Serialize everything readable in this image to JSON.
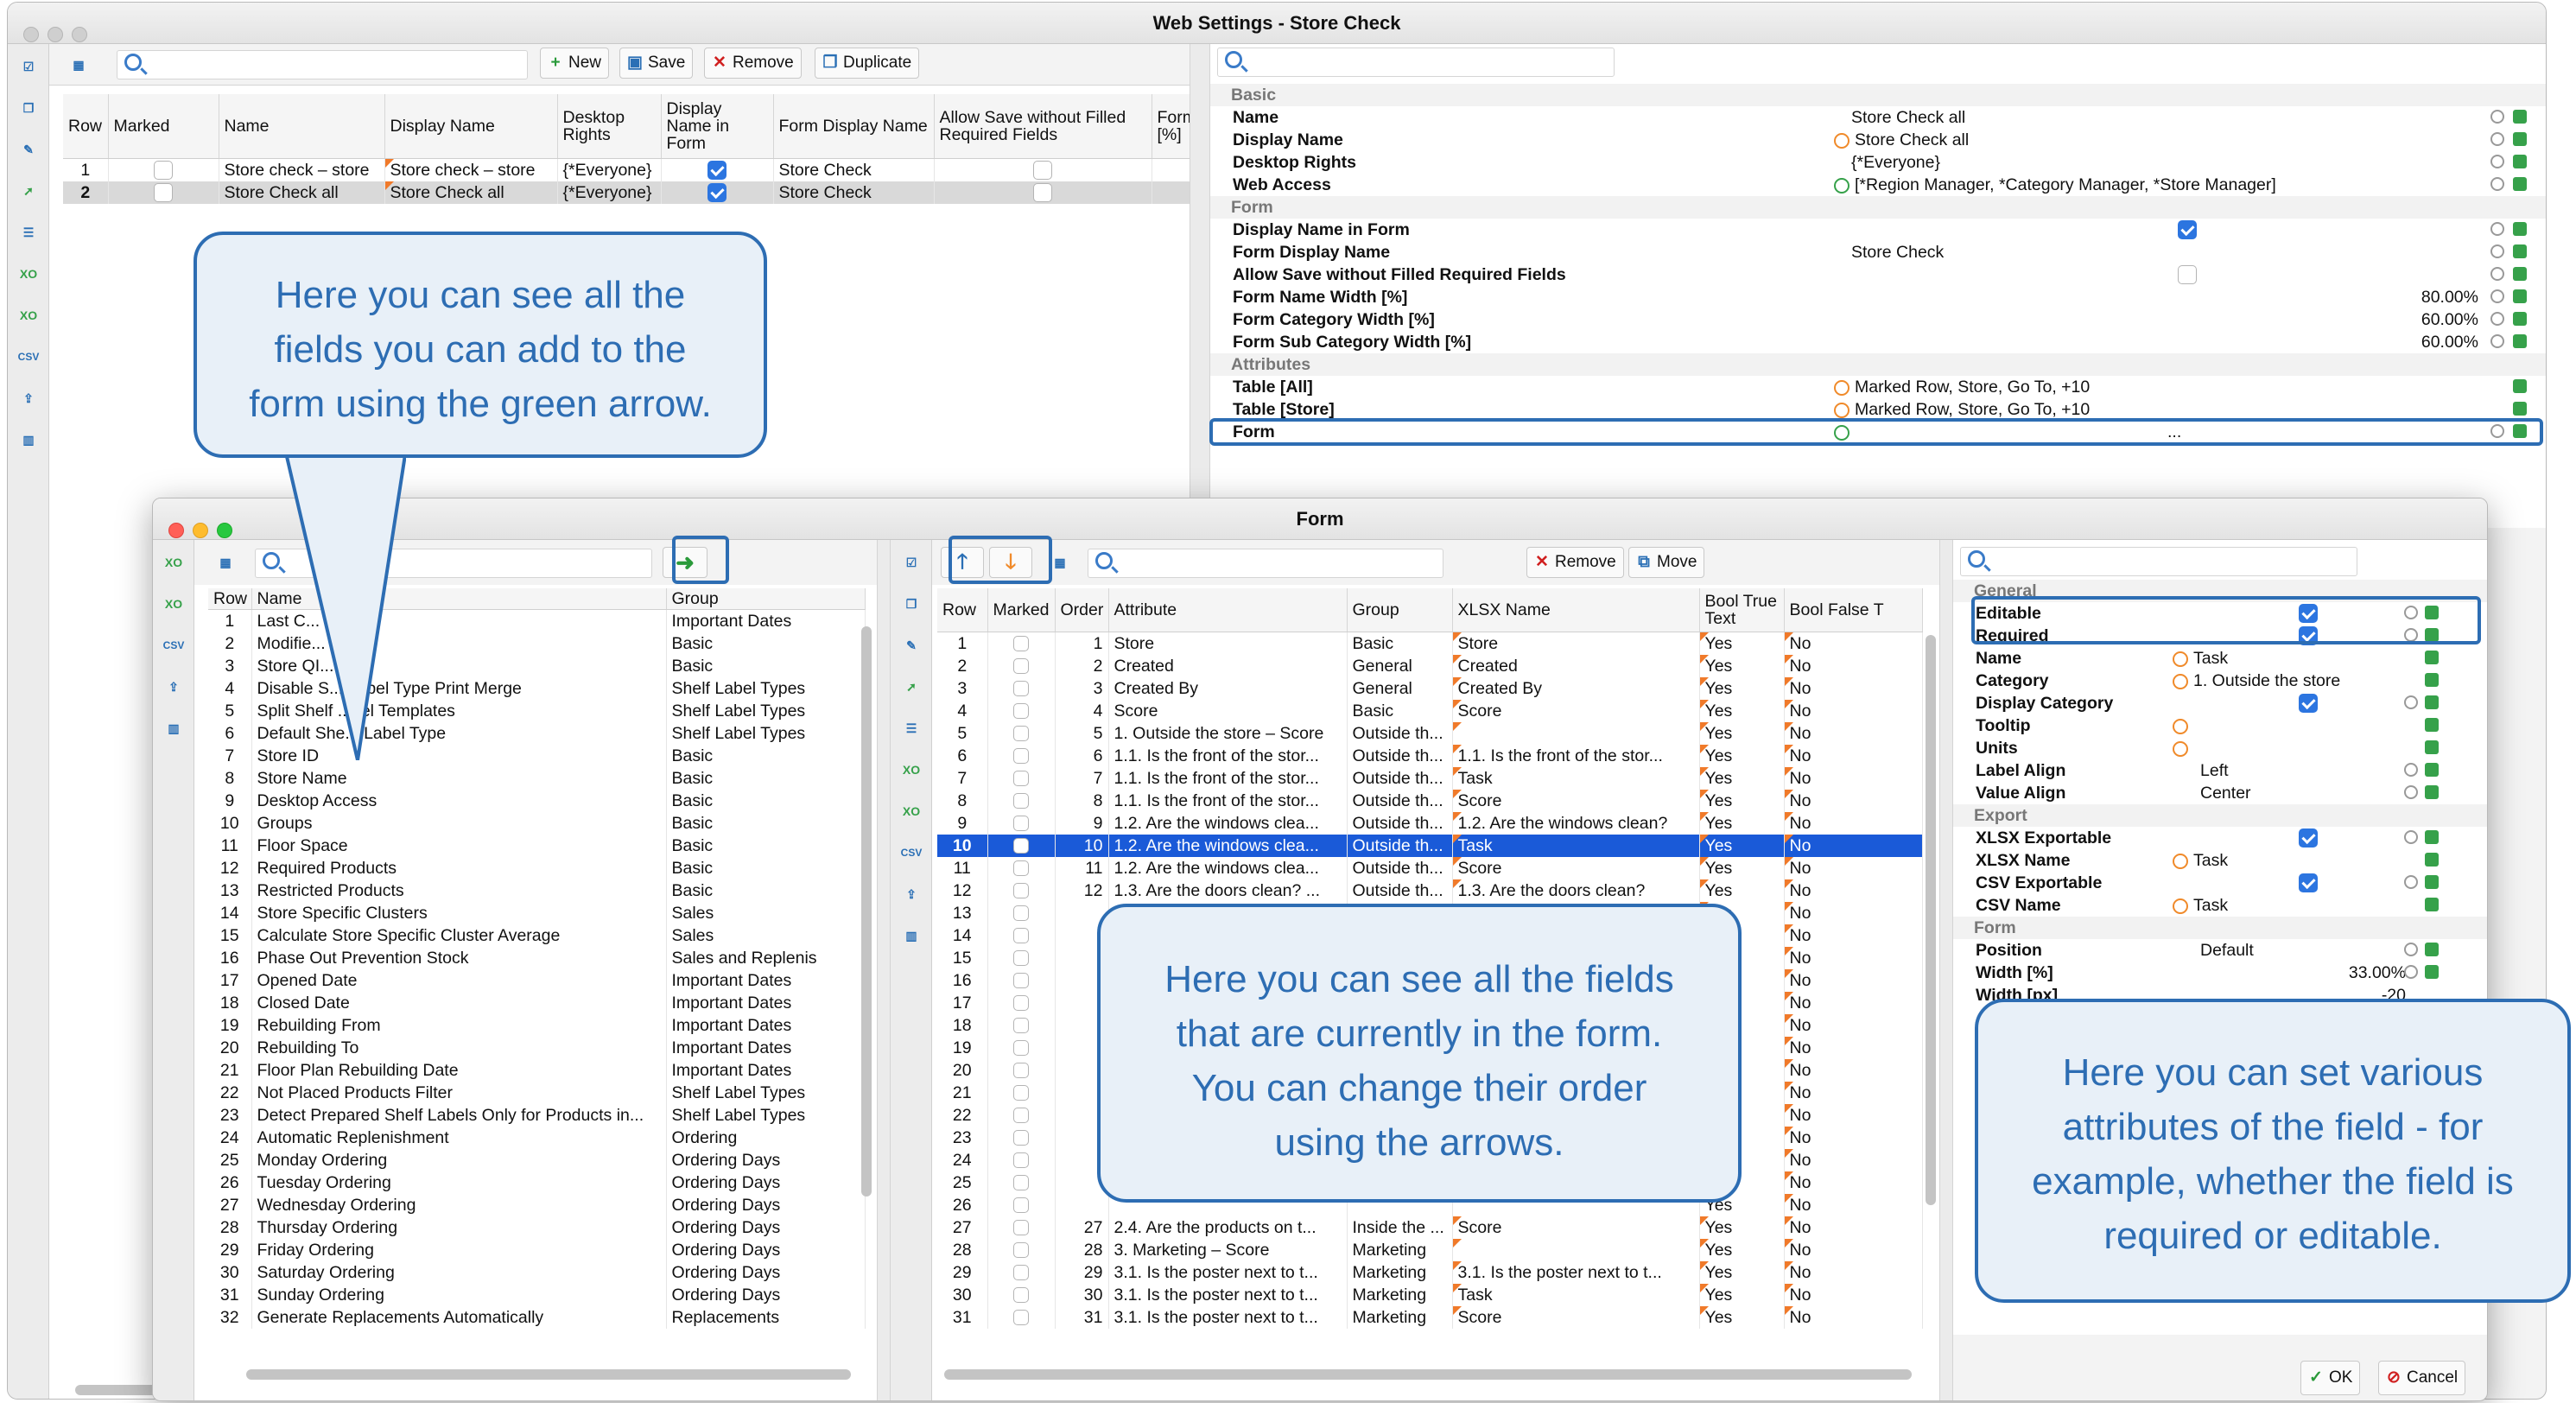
{
  "main_window": {
    "title": "Web Settings - Store Check",
    "toolbar": {
      "new_label": "New",
      "save_label": "Save",
      "remove_label": "Remove",
      "duplicate_label": "Duplicate"
    },
    "table": {
      "headers": {
        "row": "Row",
        "marked": "Marked",
        "name": "Name",
        "display_name": "Display Name",
        "desktop_rights": "Desktop Rights",
        "display_name_in_form": "Display Name in Form",
        "form_display_name": "Form Display Name",
        "allow_save": "Allow Save without Filled Required Fields",
        "form_pct": "Form [%]"
      },
      "rows": [
        {
          "row": "1",
          "name": "Store check – store",
          "display_name": "Store check – store",
          "desktop_rights": "{*Everyone}",
          "form_display_name": "Store Check"
        },
        {
          "row": "2",
          "name": "Store Check all",
          "display_name": "Store Check all",
          "desktop_rights": "{*Everyone}",
          "form_display_name": "Store Check"
        }
      ]
    },
    "properties": {
      "sections": {
        "basic": "Basic",
        "form": "Form",
        "attributes": "Attributes"
      },
      "basic": [
        {
          "key": "Name",
          "value": "Store Check all"
        },
        {
          "key": "Display Name",
          "value": "Store Check all"
        },
        {
          "key": "Desktop Rights",
          "value": "{*Everyone}"
        },
        {
          "key": "Web Access",
          "value": "[*Region Manager, *Category Manager, *Store Manager]"
        }
      ],
      "form": [
        {
          "key": "Display Name in Form",
          "value": ""
        },
        {
          "key": "Form Display Name",
          "value": "Store Check"
        },
        {
          "key": "Allow Save without Filled Required Fields",
          "value": ""
        },
        {
          "key": "Form Name Width [%]",
          "value": "80.00%"
        },
        {
          "key": "Form Category Width [%]",
          "value": "60.00%"
        },
        {
          "key": "Form Sub Category Width [%]",
          "value": "60.00%"
        }
      ],
      "attributes": [
        {
          "key": "Table [All]",
          "value": "Marked Row, Store, Go To, +10"
        },
        {
          "key": "Table [Store]",
          "value": "Marked Row, Store, Go To, +10"
        },
        {
          "key": "Form",
          "value": "..."
        }
      ]
    }
  },
  "form_window": {
    "title": "Form",
    "left_table": {
      "headers": {
        "row": "Row",
        "name": "Name",
        "group": "Group"
      },
      "rows": [
        [
          "1",
          "Last C...",
          "Important Dates"
        ],
        [
          "2",
          "Modifie...",
          "Basic"
        ],
        [
          "3",
          "Store QI...",
          "Basic"
        ],
        [
          "4",
          "Disable S... Label Type Print Merge",
          "Shelf Label Types"
        ],
        [
          "5",
          "Split Shelf ...bel Templates",
          "Shelf Label Types"
        ],
        [
          "6",
          "Default She... Label Type",
          "Shelf Label Types"
        ],
        [
          "7",
          "Store ID",
          "Basic"
        ],
        [
          "8",
          "Store Name",
          "Basic"
        ],
        [
          "9",
          "Desktop Access",
          "Basic"
        ],
        [
          "10",
          "Groups",
          "Basic"
        ],
        [
          "11",
          "Floor Space",
          "Basic"
        ],
        [
          "12",
          "Required Products",
          "Basic"
        ],
        [
          "13",
          "Restricted Products",
          "Basic"
        ],
        [
          "14",
          "Store Specific Clusters",
          "Sales"
        ],
        [
          "15",
          "Calculate Store Specific Cluster Average",
          "Sales"
        ],
        [
          "16",
          "Phase Out Prevention Stock",
          "Sales and Replenis"
        ],
        [
          "17",
          "Opened Date",
          "Important Dates"
        ],
        [
          "18",
          "Closed Date",
          "Important Dates"
        ],
        [
          "19",
          "Rebuilding From",
          "Important Dates"
        ],
        [
          "20",
          "Rebuilding To",
          "Important Dates"
        ],
        [
          "21",
          "Floor Plan Rebuilding Date",
          "Important Dates"
        ],
        [
          "22",
          "Not Placed Products Filter",
          "Shelf Label Types"
        ],
        [
          "23",
          "Detect Prepared Shelf Labels Only for Products in...",
          "Shelf Label Types"
        ],
        [
          "24",
          "Automatic Replenishment",
          "Ordering"
        ],
        [
          "25",
          "Monday Ordering",
          "Ordering Days"
        ],
        [
          "26",
          "Tuesday Ordering",
          "Ordering Days"
        ],
        [
          "27",
          "Wednesday Ordering",
          "Ordering Days"
        ],
        [
          "28",
          "Thursday Ordering",
          "Ordering Days"
        ],
        [
          "29",
          "Friday Ordering",
          "Ordering Days"
        ],
        [
          "30",
          "Saturday Ordering",
          "Ordering Days"
        ],
        [
          "31",
          "Sunday Ordering",
          "Ordering Days"
        ],
        [
          "32",
          "Generate Replacements Automatically",
          "Replacements"
        ]
      ]
    },
    "middle_toolbar": {
      "remove_label": "Remove",
      "move_label": "Move"
    },
    "middle_table": {
      "headers": {
        "row": "Row",
        "marked": "Marked",
        "order": "Order",
        "attribute": "Attribute",
        "group": "Group",
        "xlsx_name": "XLSX Name",
        "bool_true": "Bool True Text",
        "bool_false": "Bool False T"
      },
      "rows": [
        [
          "1",
          "1",
          "Store",
          "Basic",
          "Store",
          "Yes",
          "No"
        ],
        [
          "2",
          "2",
          "Created",
          "General",
          "Created",
          "Yes",
          "No"
        ],
        [
          "3",
          "3",
          "Created By",
          "General",
          "Created By",
          "Yes",
          "No"
        ],
        [
          "4",
          "4",
          "Score",
          "Basic",
          "Score",
          "Yes",
          "No"
        ],
        [
          "5",
          "5",
          "1. Outside the store – Score",
          "Outside th...",
          "",
          "Yes",
          "No"
        ],
        [
          "6",
          "6",
          "1.1. Is the front of the stor...",
          "Outside th...",
          "1.1. Is the front of the stor...",
          "Yes",
          "No"
        ],
        [
          "7",
          "7",
          "1.1. Is the front of the stor...",
          "Outside th...",
          "Task",
          "Yes",
          "No"
        ],
        [
          "8",
          "8",
          "1.1. Is the front of the stor...",
          "Outside th...",
          "Score",
          "Yes",
          "No"
        ],
        [
          "9",
          "9",
          "1.2. Are the windows clea...",
          "Outside th...",
          "1.2. Are the windows clean?",
          "Yes",
          "No"
        ],
        [
          "10",
          "10",
          "1.2. Are the windows clea...",
          "Outside th...",
          "Task",
          "Yes",
          "No"
        ],
        [
          "11",
          "11",
          "1.2. Are the windows clea...",
          "Outside th...",
          "Score",
          "Yes",
          "No"
        ],
        [
          "12",
          "12",
          "1.3. Are the doors clean? ...",
          "Outside th...",
          "1.3. Are the doors clean?",
          "Yes",
          "No"
        ],
        [
          "13",
          "",
          "",
          "",
          "",
          "Yes",
          "No"
        ],
        [
          "14",
          "",
          "",
          "",
          "",
          "Yes",
          "No"
        ],
        [
          "15",
          "",
          "",
          "",
          "",
          "Yes",
          "No"
        ],
        [
          "16",
          "",
          "",
          "",
          "",
          "Yes",
          "No"
        ],
        [
          "17",
          "",
          "",
          "",
          "",
          "Yes",
          "No"
        ],
        [
          "18",
          "",
          "",
          "",
          "",
          "Yes",
          "No"
        ],
        [
          "19",
          "",
          "",
          "",
          "",
          "Yes",
          "No"
        ],
        [
          "20",
          "",
          "",
          "",
          "",
          "Yes",
          "No"
        ],
        [
          "21",
          "",
          "",
          "",
          "",
          "Yes",
          "No"
        ],
        [
          "22",
          "",
          "",
          "",
          "",
          "Yes",
          "No"
        ],
        [
          "23",
          "",
          "",
          "",
          "",
          "Yes",
          "No"
        ],
        [
          "24",
          "",
          "",
          "",
          "",
          "Yes",
          "No"
        ],
        [
          "25",
          "",
          "",
          "",
          "",
          "Yes",
          "No"
        ],
        [
          "26",
          "",
          "",
          "",
          "",
          "Yes",
          "No"
        ],
        [
          "27",
          "27",
          "2.4. Are the products on t...",
          "Inside the ...",
          "Score",
          "Yes",
          "No"
        ],
        [
          "28",
          "28",
          "3. Marketing – Score",
          "Marketing",
          "",
          "Yes",
          "No"
        ],
        [
          "29",
          "29",
          "3.1. Is the poster next to t...",
          "Marketing",
          "3.1. Is the poster next to t...",
          "Yes",
          "No"
        ],
        [
          "30",
          "30",
          "3.1. Is the poster next to t...",
          "Marketing",
          "Task",
          "Yes",
          "No"
        ],
        [
          "31",
          "31",
          "3.1. Is the poster next to t...",
          "Marketing",
          "Score",
          "Yes",
          "No"
        ]
      ]
    },
    "right_props": {
      "sections": {
        "general": "General",
        "export": "Export",
        "form": "Form"
      },
      "general": [
        {
          "key": "Editable",
          "value": ""
        },
        {
          "key": "Required",
          "value": ""
        },
        {
          "key": "Name",
          "value": "Task"
        },
        {
          "key": "Category",
          "value": "1. Outside the store"
        },
        {
          "key": "Display Category",
          "value": ""
        },
        {
          "key": "Tooltip",
          "value": ""
        },
        {
          "key": "Units",
          "value": ""
        },
        {
          "key": "Label Align",
          "value": "Left"
        },
        {
          "key": "Value Align",
          "value": "Center"
        }
      ],
      "export": [
        {
          "key": "XLSX Exportable",
          "value": ""
        },
        {
          "key": "XLSX Name",
          "value": "Task"
        },
        {
          "key": "CSV Exportable",
          "value": ""
        },
        {
          "key": "CSV Name",
          "value": "Task"
        }
      ],
      "form": [
        {
          "key": "Position",
          "value": "Default"
        },
        {
          "key": "Width [%]",
          "value": "33.00%"
        },
        {
          "key": "Width [px]",
          "value": "-20"
        }
      ]
    },
    "ok_label": "OK",
    "cancel_label": "Cancel"
  },
  "callouts": {
    "left": "Here you can see all the fields you can add to the form using the green arrow.",
    "middle": "Here you can see all the fields that are currently in the form. You can change their order using the arrows.",
    "right": "Here you can set various attributes of the field - for example, whether the field is required or editable."
  },
  "colors": {
    "accent": "#2d6db3",
    "selection": "#1a5ad8",
    "orange_flag": "#f07a2a",
    "green": "#36a14a"
  }
}
